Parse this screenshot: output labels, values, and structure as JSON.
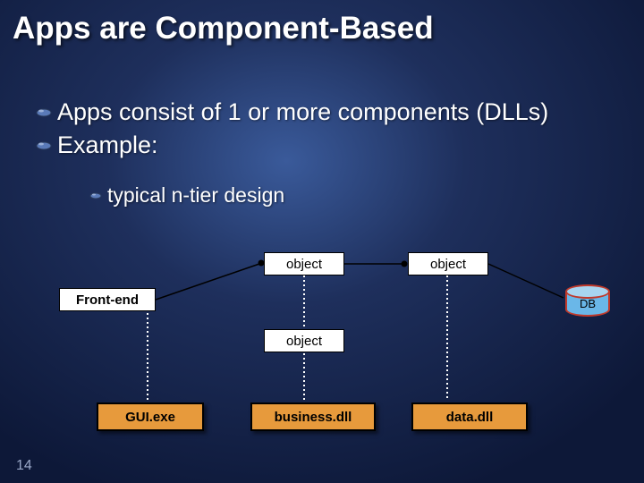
{
  "title": "Apps are Component-Based",
  "bullets": [
    "Apps consist of 1 or more components (DLLs)",
    "Example:"
  ],
  "sub_bullet": "typical n-tier design",
  "diagram": {
    "frontend": "Front-end",
    "object1": "object",
    "object2": "object",
    "object3": "object",
    "gui": "GUI.exe",
    "business": "business.dll",
    "data": "data.dll",
    "db": "DB"
  },
  "slide_number": "14"
}
